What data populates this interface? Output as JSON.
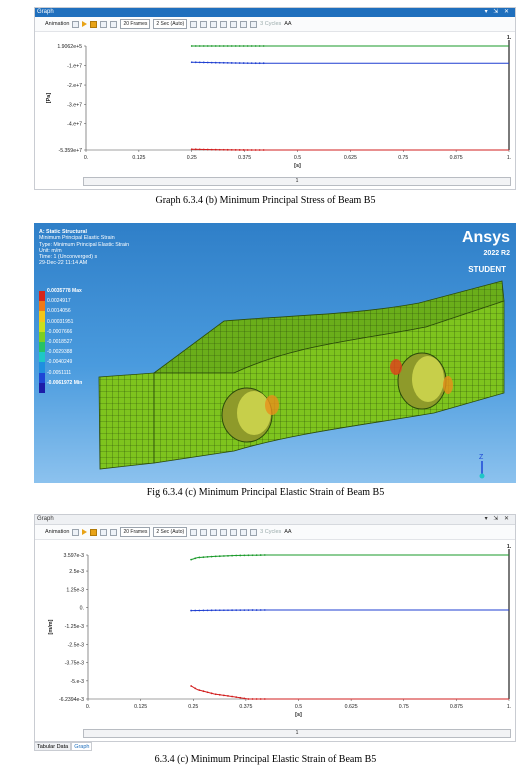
{
  "panel1": {
    "title": "Graph",
    "toolbar": {
      "animation": "Animation",
      "frames": "20 Frames",
      "duration": "2 Sec (Auto)",
      "cycles": "3 Cycles",
      "aa": "AA"
    },
    "scroll_label": "1"
  },
  "caption1": "Graph 6.3.4 (b) Minimum Principal Stress of Beam B5",
  "fem": {
    "info": [
      "A: Static Structural",
      "Minimum Principal Elastic Strain",
      "Type: Minimum Principal Elastic Strain",
      "Unit: m/m",
      "Time: 1 (Unconverged) s",
      "29-Dec-22 11:14 AM"
    ],
    "legend": [
      "0.0035778 Max",
      "0.0024917",
      "0.0014056",
      "0.00031951",
      "-0.0007666",
      "-0.0018527",
      "-0.0029388",
      "-0.0040249",
      "-0.0051111",
      "-0.0061972 Min"
    ],
    "legend_colors": [
      "#d7261b",
      "#ef7a17",
      "#f2c61a",
      "#c9df1e",
      "#7ccf24",
      "#27c266",
      "#1ec7c6",
      "#1f8fe0",
      "#1d46d6",
      "#1c1ca8"
    ],
    "logo": "Ansys",
    "version": "2022 R2",
    "student": "STUDENT",
    "axis_label": "Z"
  },
  "caption2": "Fig 6.3.4 (c) Minimum Principal Elastic Strain of Beam B5",
  "panel2": {
    "title": "Graph",
    "toolbar": {
      "animation": "Animation",
      "frames": "20 Frames",
      "duration": "2 Sec (Auto)",
      "cycles": "3 Cycles",
      "aa": "AA"
    },
    "scroll_label": "1",
    "tabs": [
      "Tabular Data",
      "Graph"
    ]
  },
  "caption3": "6.3.4 (c) Minimum Principal Elastic Strain of Beam B5",
  "chart_data": [
    {
      "type": "line",
      "xlabel": "[s]",
      "ylabel": "[Pa]",
      "xlim": [
        0,
        1
      ],
      "ylim": [
        -53590000.0,
        190620.0
      ],
      "x_ticks": [
        "0.",
        "0.125",
        "0.25",
        "0.375",
        "0.5",
        "0.625",
        "0.75",
        "0.875",
        "1."
      ],
      "y_ticks": [
        {
          "v": 190620.0,
          "t": "1.9062e+5"
        },
        {
          "v": -10000000.0,
          "t": "-1.e+7"
        },
        {
          "v": -20000000.0,
          "t": "-2.e+7"
        },
        {
          "v": -30000000.0,
          "t": "-3.e+7"
        },
        {
          "v": -40000000.0,
          "t": "-4.e+7"
        },
        {
          "v": -53590000.0,
          "t": "-5.359e+7"
        }
      ],
      "top_right_label": "1.",
      "series": [
        {
          "color": "#1a9a2a",
          "x": [
            0.25,
            1.0
          ],
          "y": [
            190620.0,
            190620.0
          ],
          "marker_x": [
            0.25,
            0.42
          ]
        },
        {
          "color": "#1f3fd1",
          "x": [
            0.25,
            0.3,
            0.35,
            0.4,
            1.0
          ],
          "y": [
            -8200000.0,
            -8400000.0,
            -8600000.0,
            -8700000.0,
            -8700000.0
          ],
          "marker_x": [
            0.25,
            0.42
          ]
        },
        {
          "color": "#d21f1f",
          "x": [
            0.25,
            0.3,
            0.35,
            0.4,
            1.0
          ],
          "y": [
            -53200000.0,
            -53400000.0,
            -53550000.0,
            -53590000.0,
            -53590000.0
          ],
          "marker_x": [
            0.25,
            0.42
          ]
        }
      ]
    },
    {
      "type": "line",
      "xlabel": "[s]",
      "ylabel": "[m/m]",
      "xlim": [
        0,
        1
      ],
      "ylim": [
        -0.0062394,
        0.003597
      ],
      "x_ticks": [
        "0.",
        "0.125",
        "0.25",
        "0.375",
        "0.5",
        "0.625",
        "0.75",
        "0.875",
        "1."
      ],
      "y_ticks": [
        {
          "v": 0.003597,
          "t": "3.597e-3"
        },
        {
          "v": 0.0025,
          "t": "2.5e-3"
        },
        {
          "v": 0.00125,
          "t": "1.25e-3"
        },
        {
          "v": 0,
          "t": "0."
        },
        {
          "v": -0.00125,
          "t": "-1.25e-3"
        },
        {
          "v": -0.0025,
          "t": "-2.5e-3"
        },
        {
          "v": -0.00375,
          "t": "-3.75e-3"
        },
        {
          "v": -0.005,
          "t": "-5.e-3"
        },
        {
          "v": -0.0062394,
          "t": "-6.2394e-3"
        }
      ],
      "top_right_label": "1.",
      "series": [
        {
          "color": "#1a9a2a",
          "x": [
            0.245,
            0.26,
            0.3,
            0.35,
            0.42,
            1.0
          ],
          "y": [
            0.00328,
            0.00342,
            0.0035,
            0.00356,
            0.003597,
            0.003597
          ],
          "marker_x": [
            0.245,
            0.42
          ]
        },
        {
          "color": "#1f3fd1",
          "x": [
            0.245,
            0.3,
            0.42,
            1.0
          ],
          "y": [
            -0.0002,
            -0.00018,
            -0.00016,
            -0.00016
          ],
          "marker_x": [
            0.245,
            0.42
          ]
        },
        {
          "color": "#d21f1f",
          "x": [
            0.245,
            0.26,
            0.3,
            0.35,
            0.38,
            0.42,
            1.0
          ],
          "y": [
            -0.00535,
            -0.0056,
            -0.0059,
            -0.0061,
            -0.0062394,
            -0.0062394,
            -0.0062394
          ],
          "marker_x": [
            0.245,
            0.42
          ]
        }
      ]
    }
  ]
}
